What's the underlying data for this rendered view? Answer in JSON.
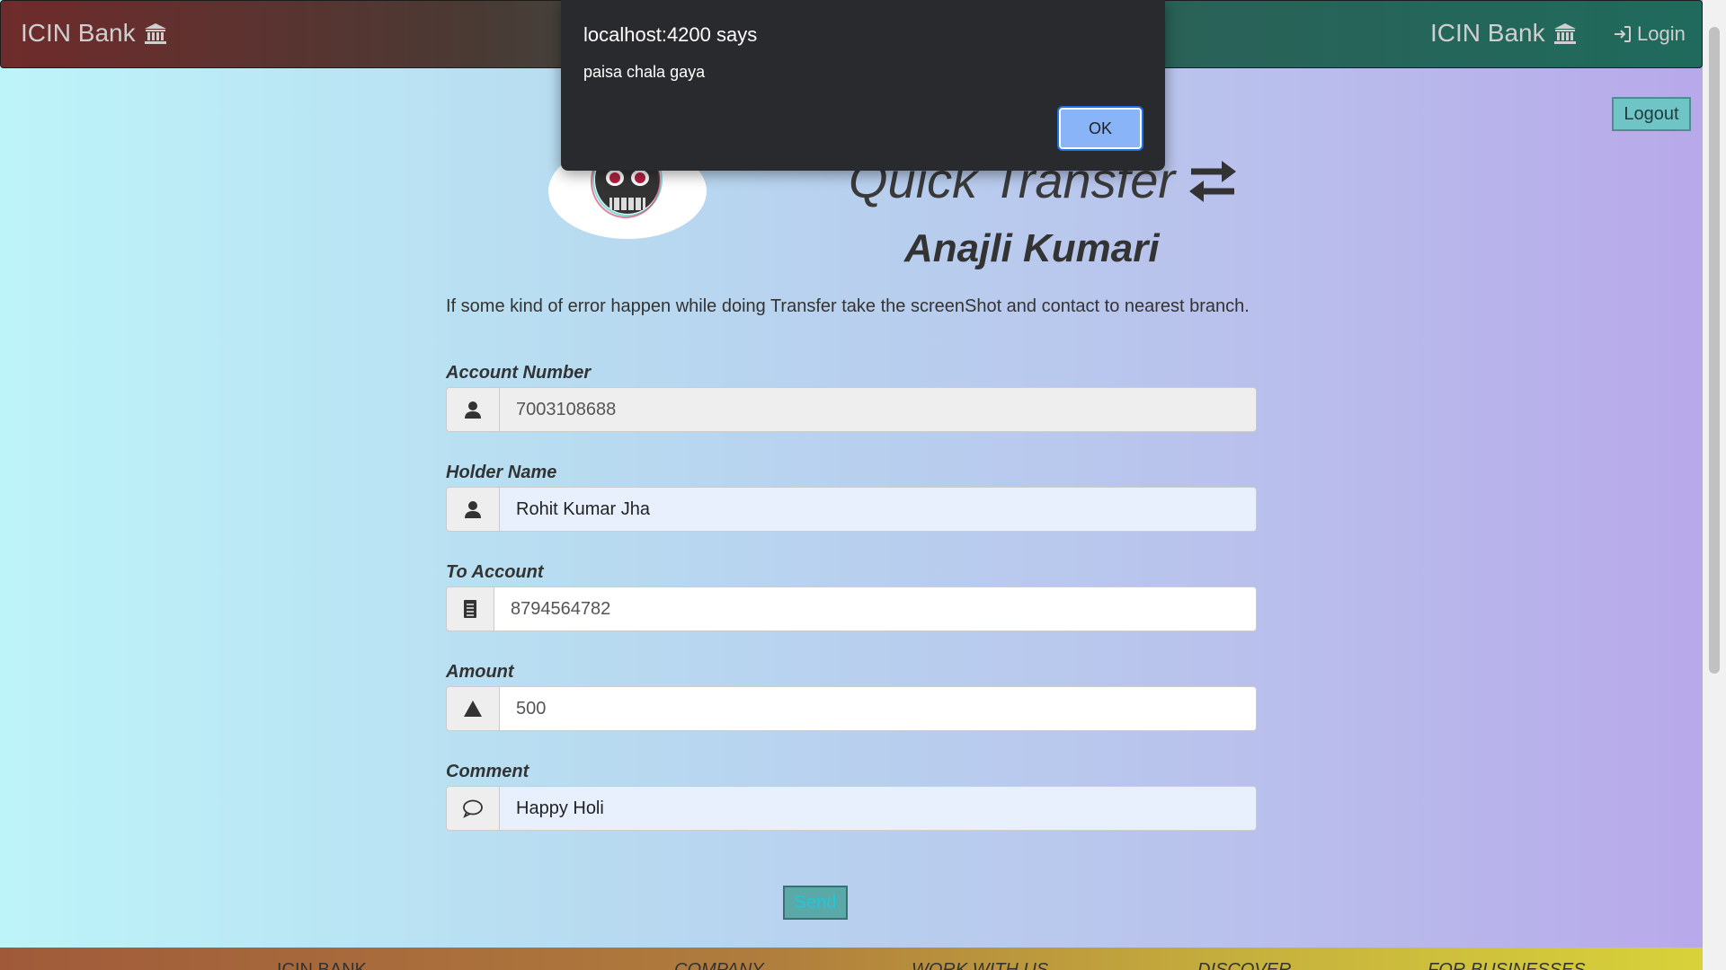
{
  "navbar": {
    "brand_left": "ICIN Bank",
    "brand_right": "ICIN Bank",
    "login_label": "Login"
  },
  "logout_label": "Logout",
  "header": {
    "title": "Quick Transfer",
    "user_name": "Anajli Kumari"
  },
  "notice": "If some kind of error happen while doing Transfer take the screenShot and contact to nearest branch.",
  "form": {
    "account_number": {
      "label": "Account Number",
      "value": "7003108688"
    },
    "holder_name": {
      "label": "Holder Name",
      "value": "Rohit Kumar Jha"
    },
    "to_account": {
      "label": "To Account",
      "value": "8794564782"
    },
    "amount": {
      "label": "Amount",
      "value": "500"
    },
    "comment": {
      "label": "Comment",
      "value": "Happy Holi"
    },
    "send_label": "Send"
  },
  "footer": {
    "columns": [
      "ICIN BANK",
      "COMPANY",
      "WORK WITH US",
      "DISCOVER",
      "FOR BUSINESSES"
    ]
  },
  "dialog": {
    "title": "localhost:4200 says",
    "message": "paisa chala gaya",
    "ok_label": "OK"
  },
  "colors": {
    "navbar_start": "#6f2b2b",
    "navbar_end": "#1f6a5c",
    "button_teal": "#6fc5c5",
    "dialog_bg": "#292a2d",
    "dialog_ok": "#8ab4f8"
  }
}
